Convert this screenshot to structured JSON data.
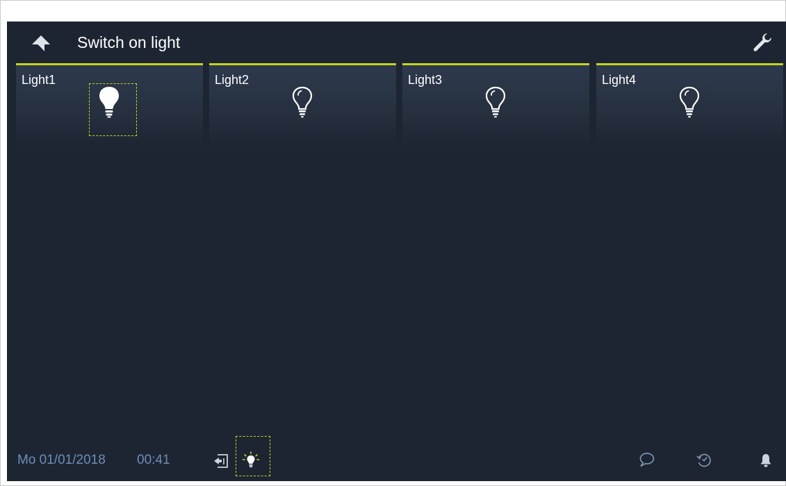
{
  "header": {
    "title": "Switch on light",
    "back_icon": "back-arrow-icon",
    "settings_icon": "wrench-icon"
  },
  "tiles": [
    {
      "label": "Light1",
      "state": "on",
      "icon": "bulb-filled-icon"
    },
    {
      "label": "Light2",
      "state": "off",
      "icon": "bulb-outline-icon"
    },
    {
      "label": "Light3",
      "state": "off",
      "icon": "bulb-outline-icon"
    },
    {
      "label": "Light4",
      "state": "off",
      "icon": "bulb-outline-icon"
    }
  ],
  "statusbar": {
    "date": "Mo 01/01/2018",
    "time": "00:41",
    "icons": [
      "door-exit-icon",
      "light-on-icon",
      "message-icon",
      "history-icon",
      "bell-icon"
    ]
  },
  "colors": {
    "background": "#1d2532",
    "accent": "#c7d51e",
    "status_text": "#6d8db8",
    "text": "#ffffff"
  }
}
